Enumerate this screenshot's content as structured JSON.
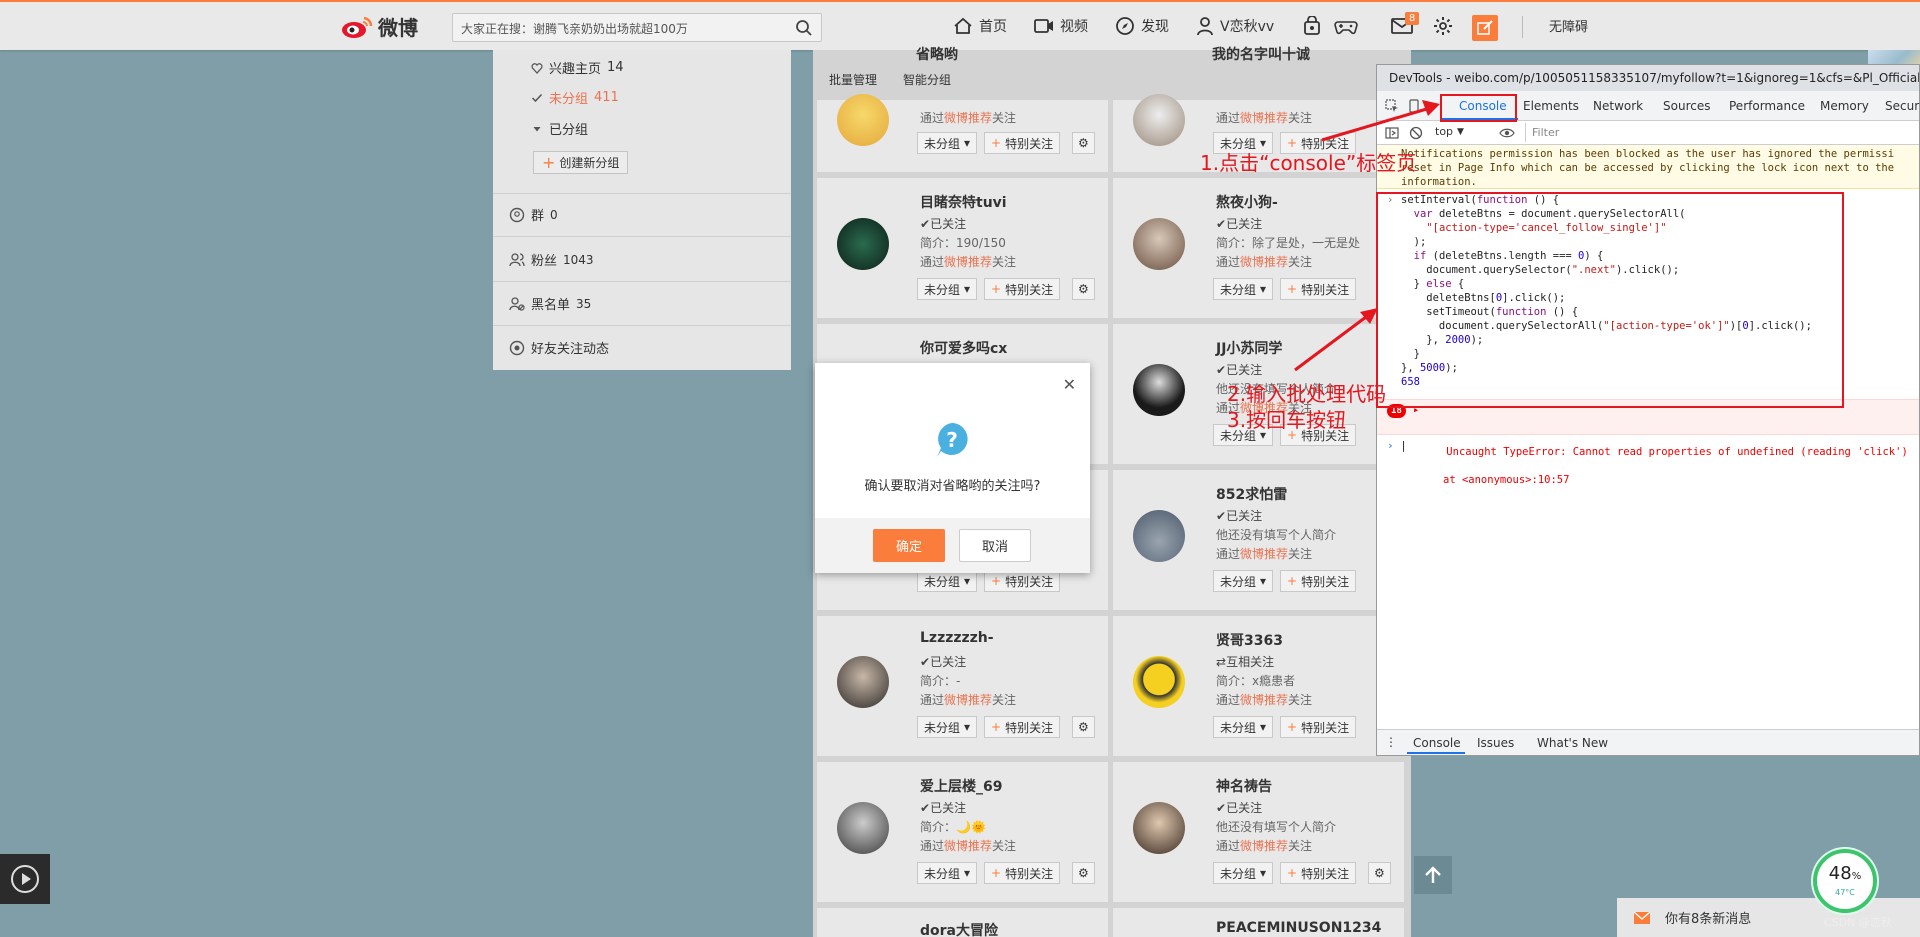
{
  "topbar": {
    "logo_text": "微博",
    "search_placeholder": "大家正在搜：谢腾飞亲奶奶出场就超100万",
    "nav": [
      {
        "label": "首页",
        "icon": "home-icon"
      },
      {
        "label": "视频",
        "icon": "video-icon"
      },
      {
        "label": "发现",
        "icon": "compass-icon"
      },
      {
        "label": "V恋秋vv",
        "icon": "user-icon"
      }
    ],
    "message_badge": "8",
    "accessibility_label": "无障碍",
    "accent_color": "#fa7d3c"
  },
  "sidebar": {
    "items": [
      {
        "label": "兴趣主页",
        "count": "14"
      },
      {
        "label": "未分组",
        "count": "411"
      },
      {
        "label": "已分组",
        "count": ""
      }
    ],
    "new_group_label": "创建新分组",
    "sections": [
      {
        "label": "群",
        "count": "0"
      },
      {
        "label": "粉丝",
        "count": "1043"
      },
      {
        "label": "黑名单",
        "count": "35"
      },
      {
        "label": "好友关注动态",
        "count": ""
      }
    ]
  },
  "main": {
    "batch_manage": "批量管理",
    "smart_group": "智能分组",
    "top_names": [
      "省略哟",
      "我的名字叫十诚"
    ],
    "source_prefix": "通过",
    "source_link": "微博推荐",
    "source_suffix": "关注",
    "group_btn": "未分组",
    "special_btn": "特别关注",
    "cards": [
      {
        "name": "目睹奈特tuvi",
        "status": "已关注",
        "bio": "简介：190/150"
      },
      {
        "name": "熬夜小狗-",
        "status": "已关注",
        "bio": "简介：除了是处，一无是处"
      },
      {
        "name": "你可爱多吗cx",
        "status": "",
        "bio": ""
      },
      {
        "name": "JJ小苏同学",
        "status": "已关注",
        "bio": "他还没有填写个人简介"
      },
      {
        "name": "",
        "status": "",
        "bio": ""
      },
      {
        "name": "852求怕雷",
        "status": "已关注",
        "bio": "他还没有填写个人简介"
      },
      {
        "name": "Lzzzzzzh-",
        "status": "已关注",
        "bio": "简介：-"
      },
      {
        "name": "贤哥3363",
        "status": "互相关注",
        "bio": "简介：x瘾患者"
      },
      {
        "name": "爱上层楼_69",
        "status": "已关注",
        "bio": "简介：🌙🌞"
      },
      {
        "name": "神名祷告",
        "status": "已关注",
        "bio": "他还没有填写个人简介"
      },
      {
        "name": "dora大冒险",
        "status": "",
        "bio": ""
      },
      {
        "name": "PEACEMINUSON1234",
        "status": "",
        "bio": ""
      }
    ]
  },
  "dialog": {
    "message": "确认要取消对省略哟的关注吗?",
    "ok_label": "确定",
    "cancel_label": "取消"
  },
  "devtools": {
    "title": "DevTools - weibo.com/p/1005051158335107/myfollow?t=1&ignoreg=1&cfs=&Pl_Official_",
    "tabs": [
      "Console",
      "Elements",
      "Network",
      "Sources",
      "Performance",
      "Memory",
      "Securi"
    ],
    "context": "top",
    "filter_placeholder": "Filter",
    "warning": "Notifications permission has been blocked as the user has ignored the permissi\nreset in Page Info which can be accessed by clicking the lock icon next to the\ninformation.",
    "result": "658",
    "error_count": "18",
    "error_text": "Uncaught TypeError: Cannot read properties of undefined (reading 'click')",
    "error_location": "at <anonymous>:10:57",
    "drawer_tabs": [
      "Console",
      "Issues",
      "What's New"
    ]
  },
  "annotations": {
    "step1": "1.点击“console”标签页",
    "step2": "2.输入批处理代码",
    "step3": "3.按回车按钮",
    "color": "#e5161e"
  },
  "widgets": {
    "gauge_percent": "48",
    "gauge_percent_sign": "%",
    "gauge_temp": "47°C",
    "new_messages": "你有8条新消息",
    "watermark": "CSDN @恋秋"
  }
}
